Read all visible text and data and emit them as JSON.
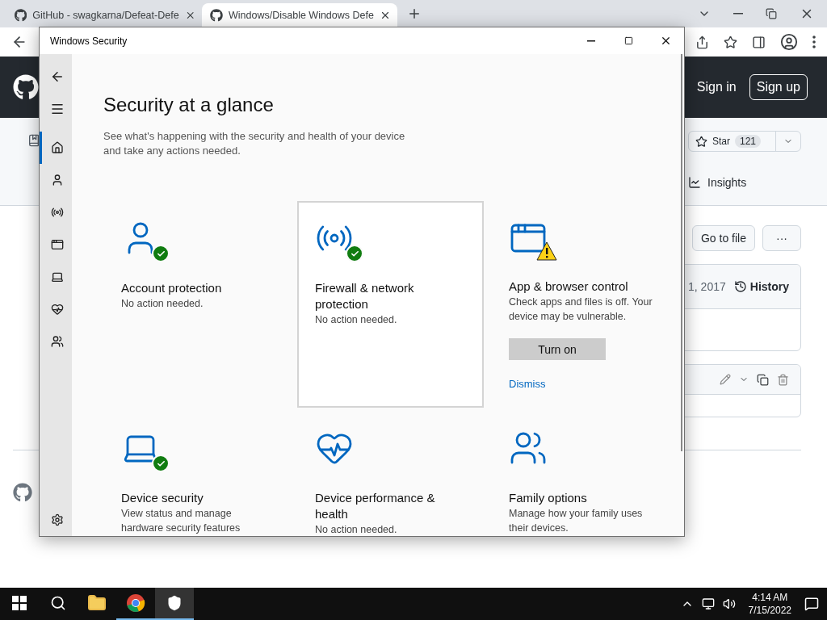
{
  "browser": {
    "tabs": [
      {
        "title": "GitHub - swagkarna/Defeat-Defe",
        "selected": false
      },
      {
        "title": "Windows/Disable Windows Defe",
        "selected": true
      }
    ],
    "github": {
      "sign_in": "Sign in",
      "sign_up": "Sign up",
      "star_label": "Star",
      "star_count": "121",
      "insights": "Insights",
      "go_to_file": "Go to file",
      "more": "···",
      "commit_date": "1, 2017",
      "history": "History"
    }
  },
  "security_window": {
    "title": "Windows Security",
    "heading": "Security at a glance",
    "description": "See what's happening with the security and health of your device and take any actions needed.",
    "nav_items": [
      {
        "kind": "home",
        "selected": true
      },
      {
        "kind": "account",
        "selected": false
      },
      {
        "kind": "firewall",
        "selected": false
      },
      {
        "kind": "app",
        "selected": false
      },
      {
        "kind": "device",
        "selected": false
      },
      {
        "kind": "performance",
        "selected": false
      },
      {
        "kind": "family",
        "selected": false
      }
    ],
    "cards": [
      {
        "kind": "account",
        "ok": true,
        "warning": false,
        "focused": false,
        "title": "Account protection",
        "status": "No action needed."
      },
      {
        "kind": "firewall",
        "ok": true,
        "warning": false,
        "focused": true,
        "title": "Firewall & network protection",
        "status": "No action needed."
      },
      {
        "kind": "app",
        "ok": false,
        "warning": true,
        "focused": false,
        "title": "App & browser control",
        "status": "Check apps and files is off. Your device may be vulnerable.",
        "action": "Turn on",
        "link": "Dismiss"
      },
      {
        "kind": "device",
        "ok": true,
        "warning": false,
        "focused": false,
        "title": "Device security",
        "status": "View status and manage hardware security features"
      },
      {
        "kind": "performance",
        "ok": false,
        "warning": false,
        "focused": false,
        "title": "Device performance & health",
        "status": "No action needed."
      },
      {
        "kind": "family",
        "ok": false,
        "warning": false,
        "focused": false,
        "title": "Family options",
        "status": "Manage how your family uses their devices."
      }
    ]
  },
  "taskbar": {
    "apps": [
      {
        "kind": "explorer",
        "running": false,
        "active": false
      },
      {
        "kind": "chrome",
        "running": true,
        "active": false
      },
      {
        "kind": "security",
        "running": true,
        "active": true
      }
    ],
    "time": "4:14 AM",
    "date": "7/15/2022"
  }
}
